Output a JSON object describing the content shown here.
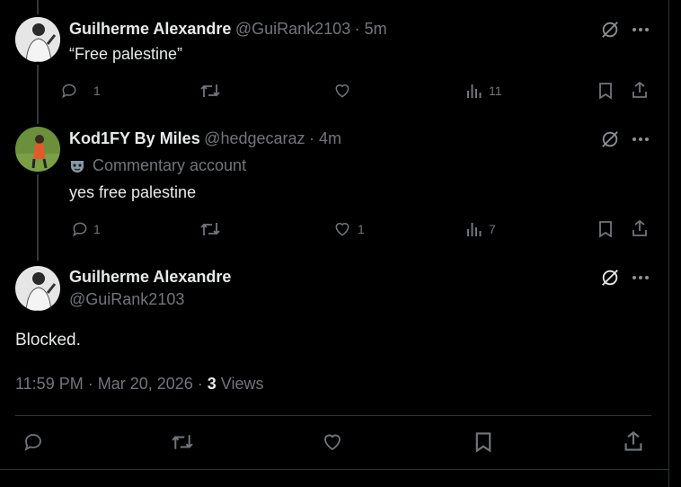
{
  "tweets": [
    {
      "name": "Guilherme Alexandre",
      "handle": "@GuiRank2103",
      "time": "· 5m",
      "text": "“Free palestine”",
      "replies": "1",
      "likes": "",
      "views": "11"
    },
    {
      "name": "Kod1FY By Miles",
      "handle": "@hedgecaraz",
      "time": "· 4m",
      "label": "Commentary account",
      "text": "yes free palestine",
      "replies": "1",
      "likes": "1",
      "views": "7"
    }
  ],
  "main_tweet": {
    "name": "Guilherme Alexandre",
    "handle": "@GuiRank2103",
    "text": "Blocked.",
    "timestamp": "11:59 PM · Mar 20, 2026 · ",
    "views_count": "3",
    "views_label": " Views"
  },
  "icons": [
    "reply-icon",
    "retweet-icon",
    "like-icon",
    "views-icon",
    "bookmark-icon",
    "share-icon",
    "grok-icon",
    "more-icon",
    "mask-icon"
  ],
  "colors": {
    "background": "#000000",
    "text": "#e7e9ea",
    "muted": "#71767b",
    "border": "#2f3336"
  }
}
